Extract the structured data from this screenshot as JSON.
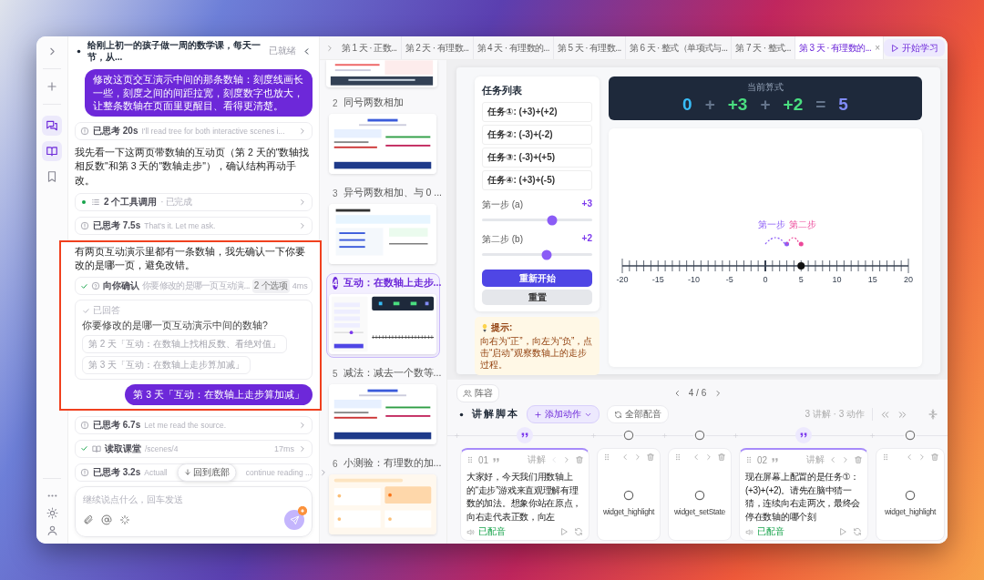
{
  "rail": [
    {
      "kind": "chat",
      "selected": true
    },
    {
      "kind": "book",
      "selected": true
    },
    {
      "kind": "bookmark",
      "selected": false
    }
  ],
  "chat": {
    "title": "给刚上初一的孩子做一周的数学课，每天一节，从...",
    "status": "已就绪",
    "scroll_button": "回到底部",
    "placeholder": "继续说点什么，回车发送",
    "messages": [
      {
        "kind": "user",
        "text": "修改这页交互演示中间的那条数轴：刻度线画长一些，刻度之间的间距拉宽，刻度数字也放大，让整条数轴在页面里更醒目、看得更清楚。"
      },
      {
        "kind": "thought",
        "label": "已思考 20s",
        "detail": "I'll read tree for both interactive scenes i..."
      },
      {
        "kind": "text",
        "text": "我先看一下这两页带数轴的互动页（第 2 天的\"数轴找相反数\"和第 3 天的\"数轴走步\"），确认结构再动手改。"
      },
      {
        "kind": "tools",
        "label": "2 个工具调用",
        "detail": "· 已完成"
      },
      {
        "kind": "thought",
        "label": "已思考 7.5s",
        "detail": "That's it. Let me ask."
      },
      {
        "kind": "annotated",
        "children": [
          {
            "kind": "text",
            "text": "有两页互动演示里都有一条数轴，我先确认一下你要改的是哪一页，避免改错。"
          },
          {
            "kind": "ask",
            "label": "向你确认",
            "detail": "你要修改的是哪一页互动演...",
            "badge": "2 个选项",
            "time": "4ms"
          },
          {
            "kind": "answered",
            "status": "已回答",
            "question": "你要修改的是哪一页互动演示中间的数轴?",
            "options": [
              "第 2 天「互动：在数轴上找相反数、看绝对值」",
              "第 3 天「互动：在数轴上走步算加减」"
            ]
          },
          {
            "kind": "user",
            "text": "第 3 天「互动：在数轴上走步算加减」"
          }
        ]
      },
      {
        "kind": "thought",
        "label": "已思考 6.7s",
        "detail": "Let me read the source."
      },
      {
        "kind": "read",
        "label": "读取课堂",
        "detail": "/scenes/4",
        "time": "17ms"
      },
      {
        "kind": "thought",
        "label": "已思考 3.2s",
        "detail": "Actuall",
        "detail_tail": "continue reading ..."
      }
    ]
  },
  "tabs": [
    {
      "label": "第 1 天 · 正数...",
      "selected": false
    },
    {
      "label": "第 2 天 · 有理数...",
      "selected": false
    },
    {
      "label": "第 4 天 · 有理数的...",
      "selected": false
    },
    {
      "label": "第 5 天 · 有理数...",
      "selected": false
    },
    {
      "label": "第 6 天 · 整式（单项式与...",
      "selected": false
    },
    {
      "label": "第 7 天 · 整式...",
      "selected": false
    },
    {
      "label": "第 3 天 · 有理数的...",
      "selected": true,
      "close": "×"
    }
  ],
  "start_button": "开始学习",
  "slides": [
    {
      "kind": "summary",
      "partial": true,
      "selected": false
    },
    {
      "kind": "rules",
      "number": "2",
      "title": "同号两数相加",
      "selected": false
    },
    {
      "kind": "examples",
      "number": "3",
      "title": "异号两数相加、与 0 ...",
      "selected": false
    },
    {
      "kind": "interactive",
      "number": "4",
      "title": "互动：在数轴上走步...",
      "selected": true
    },
    {
      "kind": "rules",
      "number": "5",
      "title": "减法：减去一个数等...",
      "selected": false
    },
    {
      "kind": "quiz",
      "number": "6",
      "title": "小测验：有理数的加...",
      "selected": false
    }
  ],
  "slide": {
    "task_title": "任务列表",
    "tasks": [
      "任务①: (+3)+(+2)",
      "任务②: (-3)+(-2)",
      "任务③: (-3)+(+5)",
      "任务④: (+3)+(-5)"
    ],
    "sliders": [
      {
        "label": "第一步 (a)",
        "reading": "+3",
        "level": 0.64
      },
      {
        "label": "第二步 (b)",
        "reading": "+2",
        "level": 0.59
      }
    ],
    "primary_button": "重新开始",
    "secondary_button": "重置",
    "hint_title": "提示:",
    "hint_text": "向右为“正”，向左为“负”，点击“启动”观察数轴上的走步过程。",
    "formula_caption": "当前算式",
    "formula": [
      {
        "kind": "start",
        "text": "0"
      },
      {
        "kind": "op",
        "text": "+"
      },
      {
        "kind": "step",
        "text": "+3"
      },
      {
        "kind": "op",
        "text": "+"
      },
      {
        "kind": "step",
        "text": "+2"
      },
      {
        "kind": "op",
        "text": "="
      },
      {
        "kind": "result",
        "text": "5"
      }
    ],
    "jumps": [
      {
        "label": "第一步",
        "color": "#8b5cf6"
      },
      {
        "label": "第二步",
        "color": "#ec4899"
      }
    ],
    "axis_labels": [
      "-20",
      "-15",
      "-10",
      "-5",
      "0",
      "5",
      "10",
      "15",
      "20"
    ]
  },
  "stage": {
    "lineup_button": "阵容",
    "pager": "4 / 6"
  },
  "script": {
    "title": "讲解脚本",
    "add_button": "添加动作",
    "dub_button": "全部配音",
    "stats": "3 讲解 · 3 动作",
    "cards": [
      {
        "kind": "narration",
        "index": "01",
        "tag": "讲解",
        "prev_disabled": true,
        "text": "大家好，今天我们用数轴上的“走步”游戏来直观理解有理数的加法。想象你站在原点，向右走代表正数，向左",
        "status": "已配音"
      },
      {
        "kind": "action",
        "name": "widget_highlight",
        "prev_disabled": false
      },
      {
        "kind": "action",
        "name": "widget_setState",
        "prev_disabled": false
      },
      {
        "kind": "narration",
        "index": "02",
        "tag": "讲解",
        "prev_disabled": false,
        "text": "现在屏幕上配置的是任务①：(+3)+(+2)。请先在脑中猜一猜，连续向右走两次，最终会停在数轴的哪个刻",
        "status": "已配音"
      },
      {
        "kind": "action",
        "name": "widget_highlight",
        "prev_disabled": false
      }
    ]
  }
}
